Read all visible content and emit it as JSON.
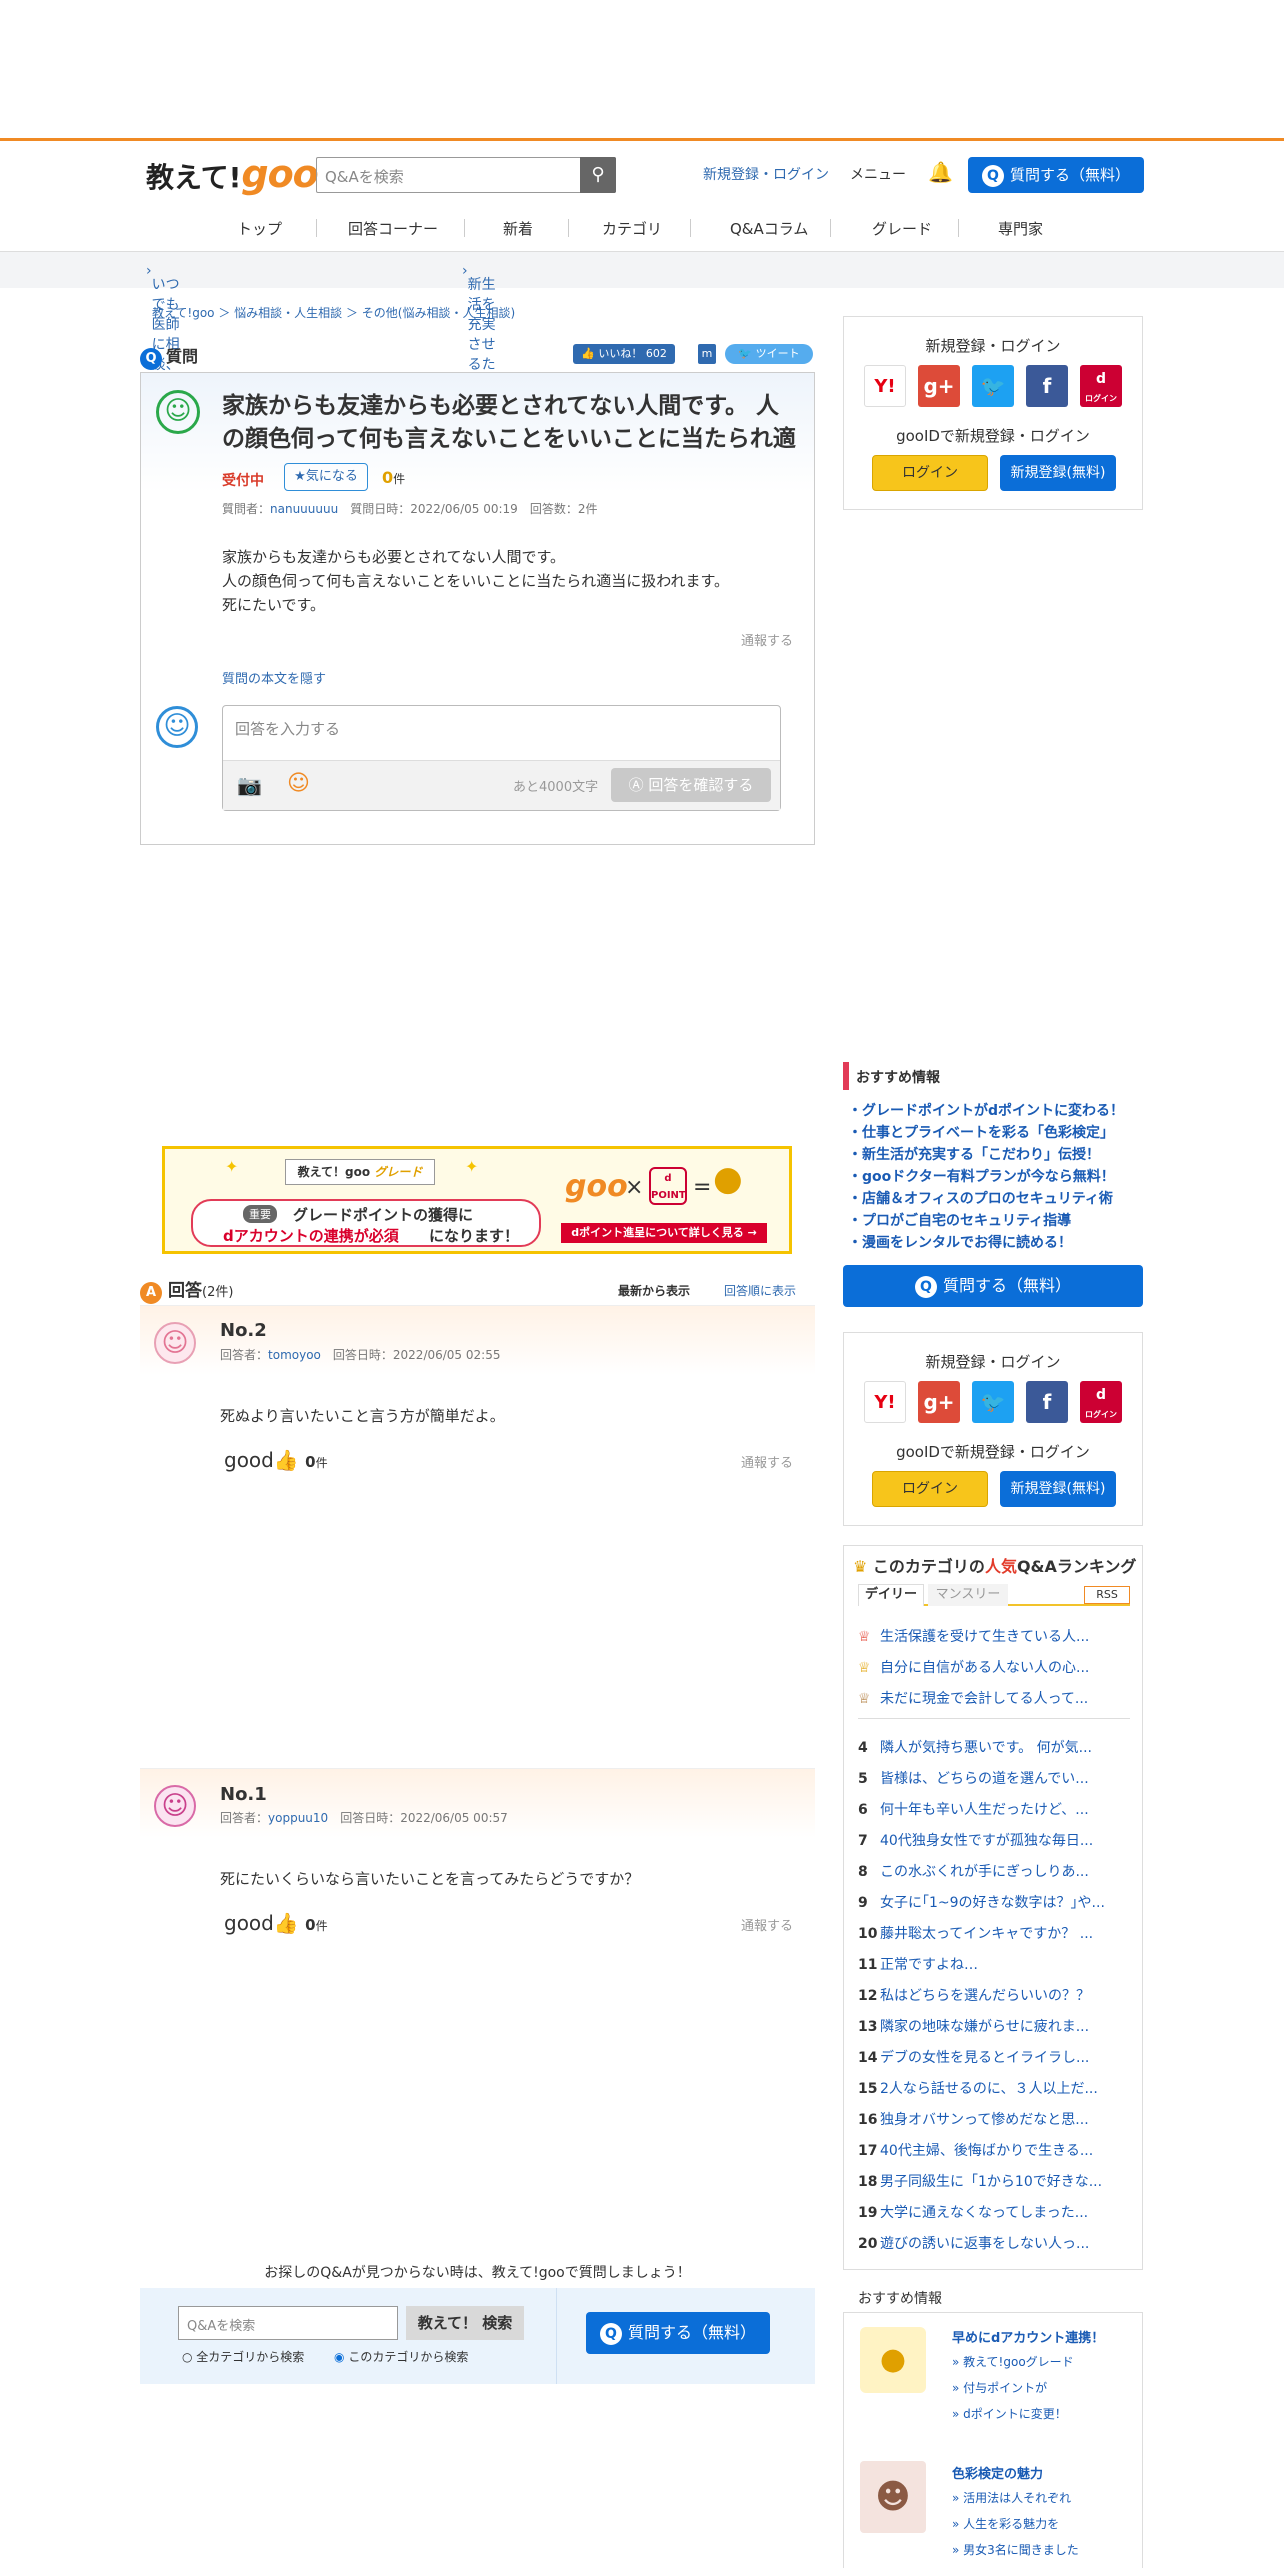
{
  "header": {
    "logo_text": "教えて!",
    "logo_goo": "goo",
    "search_placeholder": "Q&Aを検索",
    "login_link": "新規登録・ログイン",
    "menu_link": "メニュー",
    "ask_button": "質問する（無料）"
  },
  "nav": [
    "トップ",
    "回答コーナー",
    "新着",
    "カテゴリ",
    "Q&Aコラム",
    "グレード",
    "専門家"
  ],
  "subbar": [
    "いつでも医師に相談、gooドクター",
    "新生活を充実させるための「こだわり」を取材!!"
  ],
  "breadcrumb": "教えて!goo ＞ 悩み相談・人生相談 ＞ その他(悩み相談・人生相談)",
  "question": {
    "heading": "質問",
    "like_label": "いいね！ 602",
    "tweet_label": "ツイート",
    "title": "家族からも友達からも必要とされてない人間です。 人の顔色伺って何も言えないことをいいことに当たられ適",
    "status": "受付中",
    "watch_label": "気になる",
    "watch_count": "0",
    "watch_unit": "件",
    "meta_asker_label": "質問者：",
    "meta_asker": "nanuuuuuu",
    "meta_date": "質問日時：2022/06/05 00:19",
    "meta_answers": "回答数：2件",
    "body": [
      "家族からも友達からも必要とされてない人間です。",
      "人の顔色伺って何も言えないことをいいことに当たられ適当に扱われます。",
      "死にたいです。"
    ],
    "report": "通報する",
    "hide_link": "質問の本文を隠す",
    "answer_placeholder": "回答を入力する",
    "char_left": "あと4000文字",
    "confirm_button": "回答を確認する"
  },
  "sidebar": {
    "login_title": "新規登録・ログイン",
    "gooid_text": "gooIDで新規登録・ログイン",
    "login_button": "ログイン",
    "register_button": "新規登録(無料)",
    "social": [
      {
        "name": "Y!",
        "color": "#ffffff",
        "text_color": "#e60012"
      },
      {
        "name": "g+",
        "color": "#dd4b39",
        "text_color": "#ffffff"
      },
      {
        "name": "t",
        "color": "#1da1f2",
        "text_color": "#ffffff"
      },
      {
        "name": "f",
        "color": "#3b5998",
        "text_color": "#ffffff"
      },
      {
        "name": "d",
        "color": "#cc0033",
        "text_color": "#ffffff"
      }
    ],
    "docomo_small": "ログイン",
    "rec_title": "おすすめ情報",
    "rec_items": [
      "・グレードポイントがdポイントに変わる！",
      "・仕事とプライベートを彩る「色彩検定」",
      "・新生活が充実する「こだわり」伝授！",
      "・gooドクター有料プランが今なら無料！",
      "・店舗＆オフィスのプロのセキュリティ術",
      "・プロがご自宅のセキュリティ指導",
      "・漫画をレンタルでお得に読める！"
    ],
    "ask_button": "質問する（無料）",
    "ranking_title_pre": "このカテゴリの",
    "ranking_title_hot": "人気",
    "ranking_title_post": "Q&Aランキング",
    "tab_daily": "デイリー",
    "tab_monthly": "マンスリー",
    "rss": "RSS",
    "ranking": [
      "生活保護を受けて生きている人...",
      "自分に自信がある人ない人の心...",
      "未だに現金で会計してる人って...",
      "隣人が気持ち悪いです。 何が気...",
      "皆様は、どちらの道を選んでい...",
      "何十年も辛い人生だったけど、...",
      "40代独身女性ですが孤独な毎日...",
      "この水ぶくれが手にぎっしりあ...",
      "女子に｢1~9の好きな数字は？｣や...",
      "藤井聡太ってインキャですか？ ...",
      "正常ですよね…",
      "私はどちらを選んだらいいの？？",
      "隣家の地味な嫌がらせに疲れま...",
      "デブの女性を見るとイライラし...",
      "2人なら話せるのに、３人以上だ...",
      "独身オバサンって惨めだなと思...",
      "40代主婦、後悔ばかりで生きる...",
      "男子同級生に「1から10で好きな...",
      "大学に通えなくなってしまった...",
      "遊びの誘いに返事をしない人っ..."
    ],
    "rec2_title": "おすすめ情報",
    "rec2_a_title": "早めにdアカウント連携！",
    "rec2_a_items": [
      "教えて!gooグレード",
      "付与ポイントが",
      "dポイントに変更！"
    ],
    "rec2_b_title": "色彩検定の魅力",
    "rec2_b_items": [
      "活用法は人それぞれ",
      "人生を彩る魅力を",
      "男女3名に聞きました"
    ]
  },
  "banner": {
    "brand": "教えて！goo",
    "grade": "グレード",
    "tag": "重要",
    "line1": "グレードポイントの獲得に",
    "line2a": "dアカウントの連携が必須",
    "line2b": "になります！",
    "goo": "goo",
    "times": "×",
    "equals": "=",
    "dpoint": "d POINT",
    "cta": "dポイント進呈について詳しく見る →"
  },
  "answers": {
    "heading": "回答",
    "count": "(2件)",
    "sort_new": "最新から表示",
    "sort_order": "回答順に表示",
    "items": [
      {
        "no": "No.2",
        "answerer_label": "回答者：",
        "answerer": "tomoyoo",
        "date": "回答日時：2022/06/05 02:55",
        "body": "死ぬより言いたいこと言う方が簡単だよ。",
        "good": "good",
        "good_count": "0",
        "unit": "件",
        "report": "通報する"
      },
      {
        "no": "No.1",
        "answerer_label": "回答者：",
        "answerer": "yoppuu10",
        "date": "回答日時：2022/06/05 00:57",
        "body": "死にたいくらいなら言いたいことを言ってみたらどうですか？",
        "good": "good",
        "good_count": "0",
        "unit": "件",
        "report": "通報する"
      }
    ]
  },
  "footer": {
    "prompt": "お探しのQ&Aが見つからない時は、教えて!gooで質問しましょう！",
    "search_placeholder": "Q&Aを検索",
    "search_button": "教えて！ 検索",
    "radio_all": "全カテゴリから検索",
    "radio_cat": "このカテゴリから検索",
    "ask_button": "質問する（無料）"
  }
}
